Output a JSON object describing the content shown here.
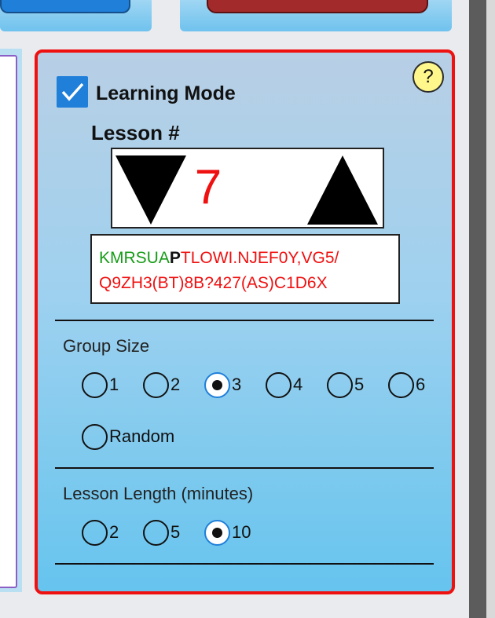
{
  "learning_mode": {
    "label": "Learning Mode",
    "checked": true
  },
  "help": {
    "glyph": "?"
  },
  "lesson": {
    "label": "Lesson #",
    "number": "7"
  },
  "keys": {
    "learned": "KMRSUA",
    "current": "P",
    "line1_rest": "TLOWI.NJEF0Y,VG5/",
    "line2": "Q9ZH3(BT)8B?427(AS)C1D6X"
  },
  "group_size": {
    "label": "Group Size",
    "options": [
      "1",
      "2",
      "3",
      "4",
      "5",
      "6",
      "Random"
    ],
    "selected": "3"
  },
  "lesson_length": {
    "label": "Lesson Length (minutes)",
    "options": [
      "2",
      "5",
      "10"
    ],
    "selected": "10"
  },
  "colors": {
    "accent": "#1f7fd9",
    "border_red": "#ef1010",
    "learned_green": "#179c17"
  }
}
